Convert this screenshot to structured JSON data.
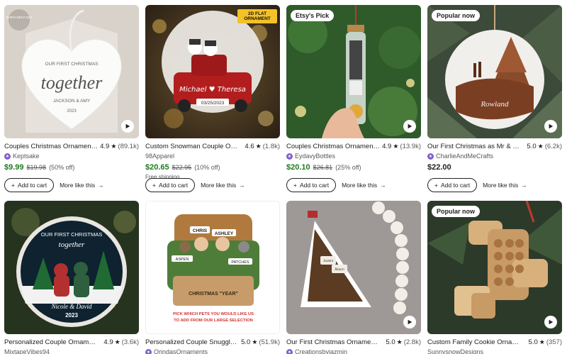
{
  "cards": [
    {
      "badge": "",
      "ships_badge": "SHIPS NEXT DAY",
      "art_text": [
        "OUR FIRST CHRISTMAS",
        "together",
        "JACKSON & AMY",
        "2023"
      ],
      "title": "Couples Christmas Ornament - F...",
      "rating": "4.9",
      "reviews": "(89.1k)",
      "shop": "Keptsake",
      "price": "$9.99",
      "original_price": "$19.98",
      "discount": "(50% off)",
      "shipping": "",
      "add_to_cart": "Add to cart",
      "more_like_this": "More like this"
    },
    {
      "badge": "2D FLAT ORNAMENT",
      "art_text": [
        "Michael",
        "Theresa",
        "03/25/2023"
      ],
      "title": "Custom Snowman Couple Orna...",
      "rating": "4.6",
      "reviews": "(1.8k)",
      "shop": "98Apparel",
      "price": "$20.65",
      "original_price": "$22.95",
      "discount": "(10% off)",
      "shipping": "Free shipping",
      "add_to_cart": "Add to cart",
      "more_like_this": "More like this"
    },
    {
      "badge": "Etsy's Pick",
      "art_text": [],
      "title": "Couples Christmas Ornament, P...",
      "rating": "4.9",
      "reviews": "(13.9k)",
      "shop": "EydavyBottles",
      "price": "$20.10",
      "original_price": "$26.81",
      "discount": "(25% off)",
      "shipping": "",
      "add_to_cart": "Add to cart",
      "more_like_this": "More like this"
    },
    {
      "badge": "Popular now",
      "art_text": [],
      "title": "Our First Christmas as Mr & Mrs ...",
      "rating": "5.0",
      "reviews": "(6.2k)",
      "shop": "CharlieAndMeCrafts",
      "price": "$22.00",
      "original_price": "",
      "discount": "",
      "shipping": "",
      "add_to_cart": "Add to cart",
      "more_like_this": "More like this"
    },
    {
      "badge": "",
      "art_text": [
        "OUR FIRST CHRISTMAS",
        "together",
        "Nicole & David",
        "2023"
      ],
      "title": "Personalized Couple Ornament, ...",
      "rating": "4.9",
      "reviews": "(3.6k)",
      "shop": "MixtapeVibes94",
      "price": "",
      "original_price": "",
      "discount": "",
      "shipping": "",
      "add_to_cart": "",
      "more_like_this": ""
    },
    {
      "badge": "",
      "art_text": [
        "CHRIS",
        "ASHLEY",
        "ASPEN",
        "PATCHES",
        "CHRISTMAS \"YEAR\"",
        "PICK WHICH PETS YOU WOULD LIKE US",
        "TO ADD FROM OUR LARGE SELECTION"
      ],
      "title": "Personalized Couple Snuggled i...",
      "rating": "5.0",
      "reviews": "(51.9k)",
      "shop": "OrindasOrnaments",
      "price": "",
      "original_price": "",
      "discount": "",
      "shipping": "",
      "add_to_cart": "",
      "more_like_this": ""
    },
    {
      "badge": "",
      "art_text": [],
      "title": "Our First Christmas Ornament 2...",
      "rating": "5.0",
      "reviews": "(2.8k)",
      "shop": "Creationsbyjazmin",
      "price": "",
      "original_price": "",
      "discount": "",
      "shipping": "",
      "add_to_cart": "",
      "more_like_this": ""
    },
    {
      "badge": "Popular now",
      "art_text": [],
      "title": "Custom Family Cookie Ornamen...",
      "rating": "5.0",
      "reviews": "(357)",
      "shop": "SunnysnowDesigns",
      "price": "",
      "original_price": "",
      "discount": "",
      "shipping": "",
      "add_to_cart": "",
      "more_like_this": ""
    }
  ],
  "colors": {
    "sale_price": "#1f7a1f",
    "star_seller": "#7f5fcb",
    "text": "#222222",
    "muted": "#595959"
  }
}
